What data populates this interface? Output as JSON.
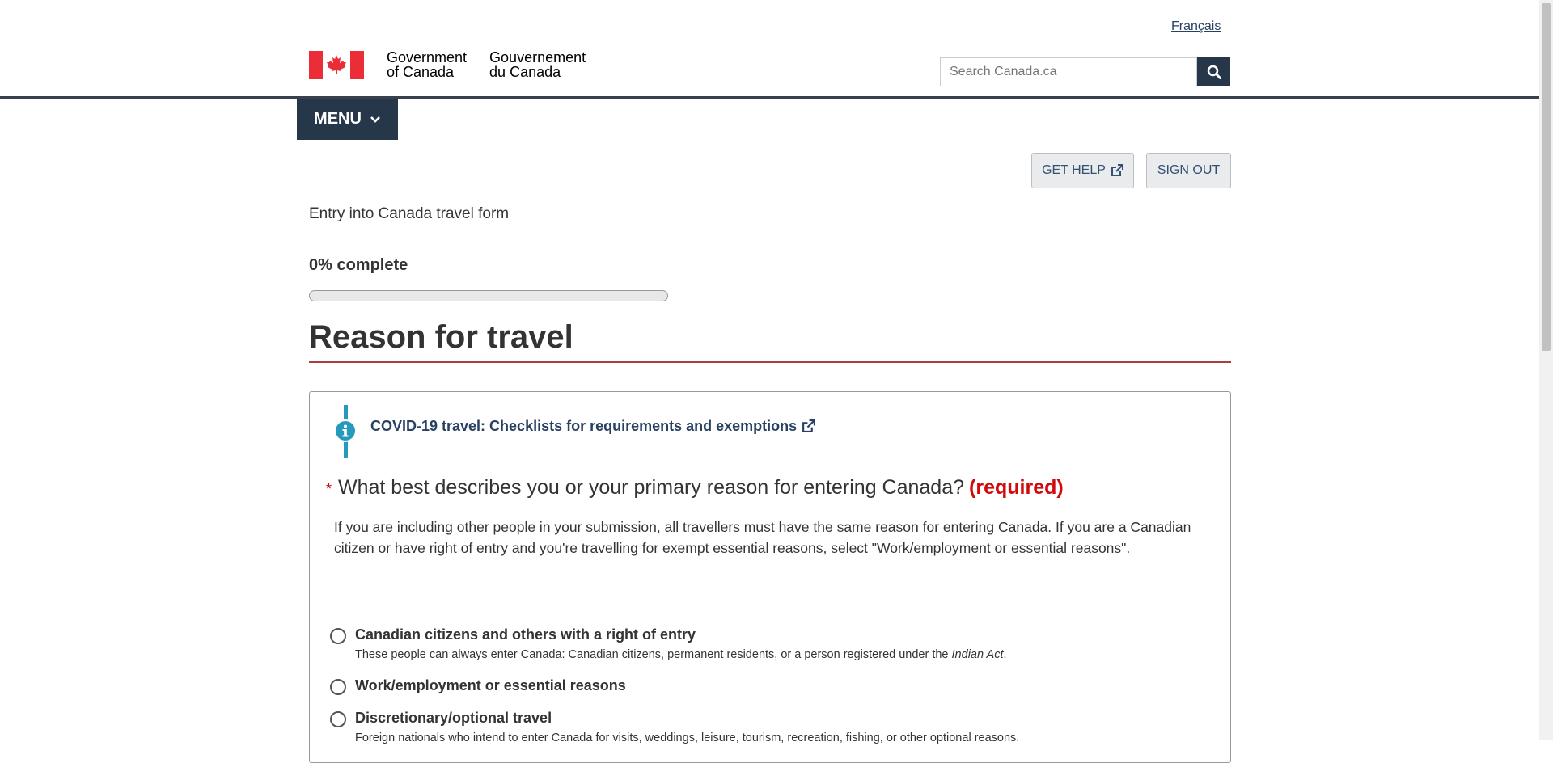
{
  "header": {
    "language_link": "Français",
    "signature_en_line1": "Government",
    "signature_en_line2": "of Canada",
    "signature_fr_line1": "Gouvernement",
    "signature_fr_line2": "du Canada",
    "search_placeholder": "Search Canada.ca",
    "menu_label": "MENU"
  },
  "toolbar": {
    "get_help_label": "GET HELP",
    "sign_out_label": "SIGN OUT"
  },
  "form": {
    "title": "Entry into Canada travel form",
    "progress_text": "0% complete",
    "progress_fraction": 0
  },
  "section": {
    "heading": "Reason for travel",
    "info_link": "COVID-19 travel: Checklists for requirements and exemptions",
    "question": "What best describes you or your primary reason for entering Canada?",
    "required_marker": "*",
    "required_label": "(required)",
    "help_text": "If you are including other people in your submission, all travellers must have the same reason for entering Canada. If you are a Canadian citizen or have right of entry and you're travelling for exempt essential reasons, select \"Work/employment or essential reasons\".",
    "options": [
      {
        "label": "Canadian citizens and others with a right of entry",
        "desc_before": "These people can always enter Canada: Canadian citizens, permanent residents, or a person registered under the ",
        "desc_em": "Indian Act",
        "desc_after": "."
      },
      {
        "label": "Work/employment or essential reasons"
      },
      {
        "label": "Discretionary/optional travel",
        "desc": "Foreign nationals who intend to enter Canada for visits, weddings, leisure, tourism, recreation, fishing, or other optional reasons."
      }
    ]
  },
  "colors": {
    "navy": "#26374a",
    "flag_red": "#eb2d37",
    "heading_rule": "#af3c43",
    "required_red": "#d3080c",
    "info_blue": "#269abc",
    "link": "#284162"
  },
  "icons": [
    "maple-leaf-icon",
    "search-icon",
    "chevron-down-icon",
    "external-link-icon",
    "info-icon"
  ]
}
